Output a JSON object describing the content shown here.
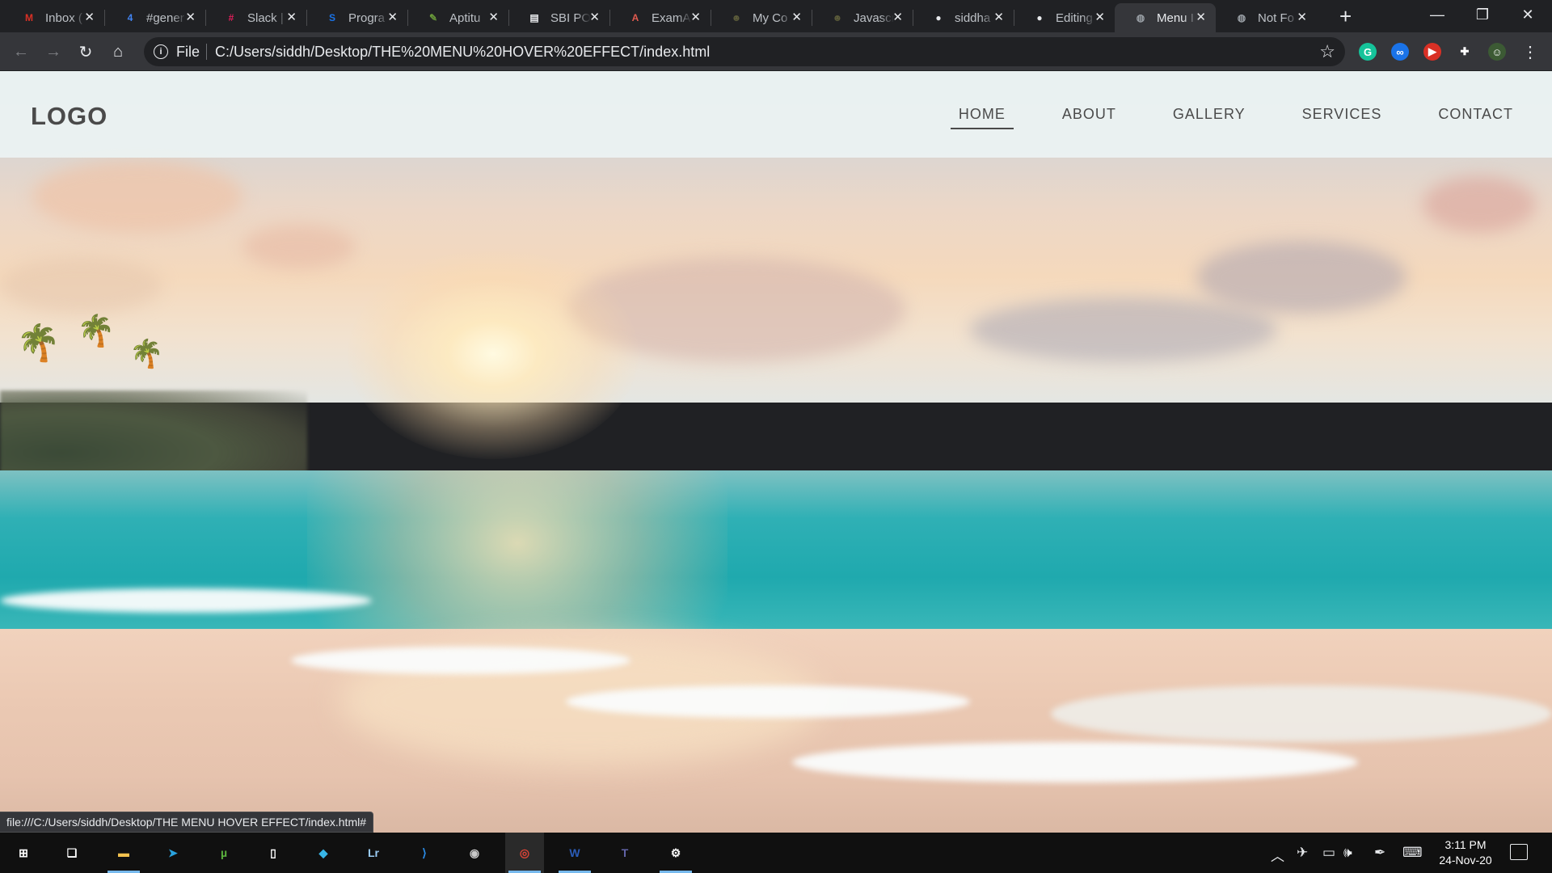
{
  "browser": {
    "tabs": [
      {
        "title": "Inbox (",
        "icon": "gmail-icon",
        "color": "#d93025",
        "glyph": "M",
        "active": false
      },
      {
        "title": "#gener",
        "icon": "google-calendar-icon",
        "color": "#4285f4",
        "glyph": "4",
        "active": false
      },
      {
        "title": "Slack |",
        "icon": "slack-icon",
        "color": "#e01e5a",
        "glyph": "#",
        "active": false
      },
      {
        "title": "Progra",
        "icon": "s-logo-icon",
        "color": "#1a73e8",
        "glyph": "S",
        "active": false
      },
      {
        "title": "Aptitu",
        "icon": "leaf-icon",
        "color": "#6a9a3a",
        "glyph": "✎",
        "active": false
      },
      {
        "title": "SBI PO",
        "icon": "document-icon",
        "color": "#e8eaed",
        "glyph": "▤",
        "active": false
      },
      {
        "title": "ExamA",
        "icon": "exam-app-icon",
        "color": "#e05a4f",
        "glyph": "A",
        "active": false
      },
      {
        "title": "My Co",
        "icon": "coding-ninjas-icon",
        "color": "#5b5b3a",
        "glyph": "☻",
        "active": false
      },
      {
        "title": "Javascr",
        "icon": "coding-ninjas-icon",
        "color": "#5b5b3a",
        "glyph": "☻",
        "active": false
      },
      {
        "title": "siddha",
        "icon": "github-icon",
        "color": "#e8eaed",
        "glyph": "●",
        "active": false
      },
      {
        "title": "Editing",
        "icon": "github-icon",
        "color": "#e8eaed",
        "glyph": "●",
        "active": false
      },
      {
        "title": "Menu I",
        "icon": "globe-icon",
        "color": "#9aa0a6",
        "glyph": "◍",
        "active": true
      },
      {
        "title": "Not Fo",
        "icon": "globe-icon",
        "color": "#9aa0a6",
        "glyph": "◍",
        "active": false
      }
    ],
    "new_tab": "+",
    "window": {
      "minimize": "—",
      "maximize": "❐",
      "close": "✕"
    },
    "omnibox": {
      "scheme": "File",
      "url": "C:/Users/siddh/Desktop/THE%20MENU%20HOVER%20EFFECT/index.html"
    },
    "status_url": "file:///C:/Users/siddh/Desktop/THE MENU HOVER EFFECT/index.html#",
    "extensions": [
      {
        "name": "grammarly-icon",
        "color": "#15c39a",
        "glyph": "G"
      },
      {
        "name": "loop-extension-icon",
        "color": "#1a73e8",
        "glyph": "∞"
      },
      {
        "name": "video-extension-icon",
        "color": "#d93025",
        "glyph": "▶"
      },
      {
        "name": "puzzle-extensions-icon",
        "color": "#35363a",
        "glyph": "✚"
      },
      {
        "name": "profile-avatar-icon",
        "color": "#3c5a34",
        "glyph": "☺"
      }
    ]
  },
  "site": {
    "logo": "LOGO",
    "nav": [
      {
        "label": "HOME",
        "active": true
      },
      {
        "label": "ABOUT",
        "active": false
      },
      {
        "label": "GALLERY",
        "active": false
      },
      {
        "label": "SERVICES",
        "active": false
      },
      {
        "label": "CONTACT",
        "active": false
      }
    ]
  },
  "taskbar": {
    "apps": [
      {
        "name": "start-icon",
        "color": "#ffffff",
        "glyph": "⊞",
        "running": false,
        "active": false
      },
      {
        "name": "task-view-icon",
        "color": "#ffffff",
        "glyph": "❏",
        "running": false,
        "active": false
      },
      {
        "name": "file-explorer-icon",
        "color": "#f2c14e",
        "glyph": "▬",
        "running": true,
        "active": false
      },
      {
        "name": "telegram-icon",
        "color": "#2aa3df",
        "glyph": "➤",
        "running": false,
        "active": false
      },
      {
        "name": "utorrent-icon",
        "color": "#5bb33e",
        "glyph": "µ",
        "running": false,
        "active": false
      },
      {
        "name": "notepad-icon",
        "color": "#ffffff",
        "glyph": "▯",
        "running": false,
        "active": false
      },
      {
        "name": "paint-3d-icon",
        "color": "#38b6e8",
        "glyph": "◆",
        "running": false,
        "active": false
      },
      {
        "name": "lightroom-icon",
        "color": "#9ccdf5",
        "glyph": "Lr",
        "running": false,
        "active": false
      },
      {
        "name": "vscode-icon",
        "color": "#2b8ce8",
        "glyph": "⟩",
        "running": false,
        "active": false
      },
      {
        "name": "camera-icon",
        "color": "#c9c9c9",
        "glyph": "◉",
        "running": false,
        "active": false
      },
      {
        "name": "chrome-icon",
        "color": "#db4437",
        "glyph": "◎",
        "running": true,
        "active": true
      },
      {
        "name": "word-icon",
        "color": "#2b5cb8",
        "glyph": "W",
        "running": true,
        "active": false
      },
      {
        "name": "teams-icon",
        "color": "#6264a7",
        "glyph": "T",
        "running": false,
        "active": false
      },
      {
        "name": "settings-icon",
        "color": "#ffffff",
        "glyph": "⚙",
        "running": true,
        "active": false
      }
    ],
    "tray": [
      {
        "name": "show-hidden-icons-chevron-icon",
        "glyph": "︿"
      },
      {
        "name": "airplane-mode-icon",
        "glyph": "✈"
      },
      {
        "name": "battery-icon",
        "glyph": "▭"
      },
      {
        "name": "volume-icon",
        "glyph": "🕪"
      },
      {
        "name": "pen-ink-icon",
        "glyph": "✒"
      },
      {
        "name": "keyboard-icon",
        "glyph": "⌨"
      }
    ],
    "time": "3:11 PM",
    "date": "24-Nov-20"
  }
}
